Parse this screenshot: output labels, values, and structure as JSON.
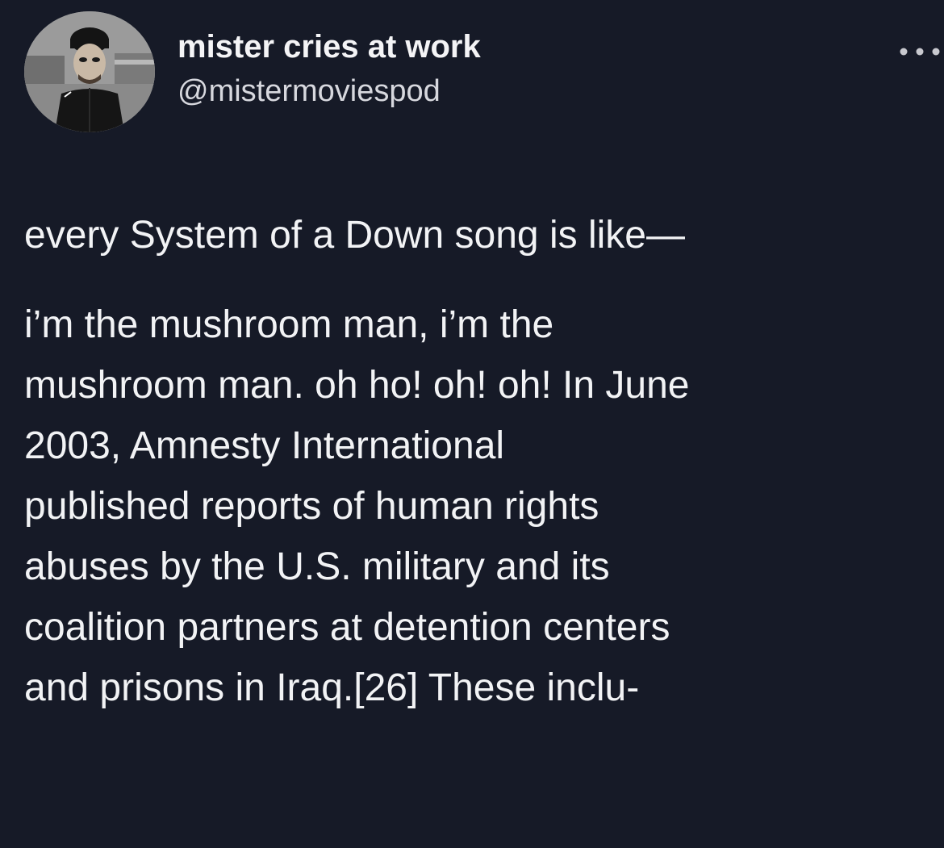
{
  "tweet": {
    "display_name": "mister cries at work",
    "handle": "@mistermoviespod",
    "more_icon": "ellipsis-icon",
    "avatar_icon": "profile-avatar",
    "first_line": "every System of a Down song is like—",
    "lines": [
      "i’m the mushroom man, i’m the",
      "mushroom man. oh ho! oh! oh! In June",
      "2003, Amnesty International",
      "published reports of human rights",
      "abuses by the U.S. military and its",
      "coalition partners at detention centers",
      "and prisons in Iraq.[26] These inclu-"
    ]
  },
  "colors": {
    "background": "#161a27",
    "text": "#f2f3f5",
    "handle": "#d7d8de"
  }
}
